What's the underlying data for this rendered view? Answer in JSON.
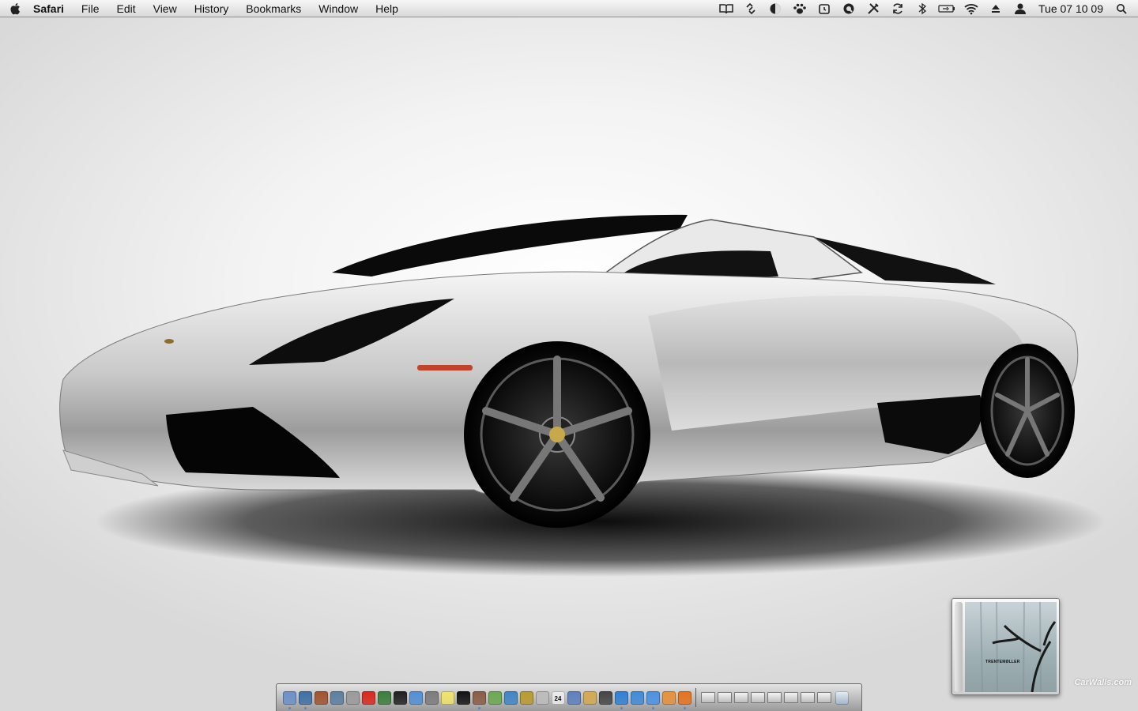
{
  "menubar": {
    "apple_icon": "apple-icon",
    "app_name": "Safari",
    "menus": [
      "File",
      "Edit",
      "View",
      "History",
      "Bookmarks",
      "Window",
      "Help"
    ],
    "status_icons": [
      "dictionary-icon",
      "link-icon",
      "moon-icon",
      "paw-icon",
      "alarm-clock-icon",
      "q-app-icon",
      "tools-icon",
      "sync-icon",
      "bluetooth-icon",
      "battery-icon",
      "wifi-icon",
      "eject-icon",
      "user-icon"
    ],
    "clock": "Tue 07 10 09",
    "spotlight_icon": "spotlight-search-icon"
  },
  "wallpaper": {
    "subject": "silver sports car",
    "watermark": "CarWalls.com"
  },
  "album_widget": {
    "artist_text": "TRENTEMØLLER"
  },
  "dock": {
    "apps": [
      {
        "name": "finder",
        "color": "#6b8fc9",
        "running": true
      },
      {
        "name": "dashboard",
        "color": "#3c6fa6",
        "running": true
      },
      {
        "name": "brown-app",
        "color": "#a0522d",
        "running": false
      },
      {
        "name": "preview",
        "color": "#5a7ea0",
        "running": false
      },
      {
        "name": "address-book",
        "color": "#9a9a9a",
        "running": false
      },
      {
        "name": "red-app",
        "color": "#d9261c",
        "running": false
      },
      {
        "name": "time-machine",
        "color": "#3a7d3a",
        "running": false
      },
      {
        "name": "activity-monitor",
        "color": "#1e1e1e",
        "running": false
      },
      {
        "name": "screens",
        "color": "#4f8fd6",
        "running": false
      },
      {
        "name": "system-prefs",
        "color": "#7b7b7b",
        "running": false
      },
      {
        "name": "stickies",
        "color": "#f1e36a",
        "running": false
      },
      {
        "name": "terminal",
        "color": "#111111",
        "running": false
      },
      {
        "name": "photo-app",
        "color": "#8a5a44",
        "running": true
      },
      {
        "name": "green-app",
        "color": "#6aa84f",
        "running": false
      },
      {
        "name": "toolbar-app",
        "color": "#3d85c6",
        "running": false
      },
      {
        "name": "gold-app",
        "color": "#b99a2e",
        "running": false
      },
      {
        "name": "calculator",
        "color": "#bcbcbc",
        "running": false
      },
      {
        "name": "ical",
        "color": "#ececec",
        "running": false,
        "label": "24"
      },
      {
        "name": "mail",
        "color": "#5b7fbf",
        "running": false
      },
      {
        "name": "notes",
        "color": "#d4a84f",
        "running": false
      },
      {
        "name": "dark-app",
        "color": "#444444",
        "running": false
      },
      {
        "name": "safari",
        "color": "#2e7fd3",
        "running": true
      },
      {
        "name": "search-app",
        "color": "#3d8bd9",
        "running": false
      },
      {
        "name": "itunes",
        "color": "#4a90e2",
        "running": true
      },
      {
        "name": "colorsync",
        "color": "#e69138",
        "running": false
      },
      {
        "name": "firefox",
        "color": "#e6711b",
        "running": true
      }
    ],
    "minimized_count": 8,
    "trash_icon": "trash-icon"
  }
}
